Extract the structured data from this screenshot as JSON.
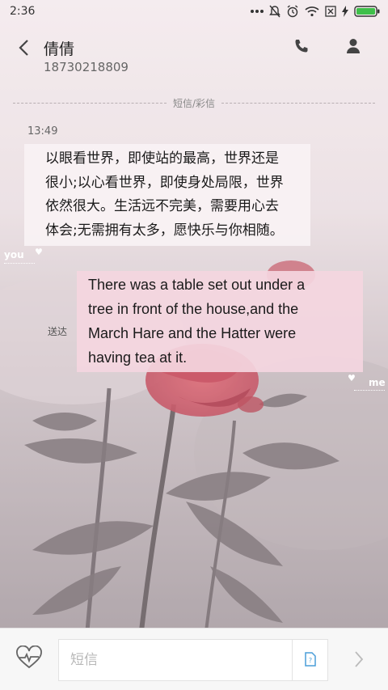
{
  "status_bar": {
    "time": "2:36",
    "icons": [
      "more-dots-icon",
      "mute-icon",
      "alarm-icon",
      "wifi-icon",
      "no-sim-icon",
      "charging-icon",
      "battery-icon"
    ]
  },
  "header": {
    "back_icon": "chevron-left-icon",
    "contact_name": "倩倩",
    "contact_number": "18730218809",
    "call_icon": "phone-icon",
    "profile_icon": "person-icon"
  },
  "conversation": {
    "channel_label": "短信/彩信",
    "timestamp": "13:49",
    "incoming": {
      "lines": [
        "以眼看世界，即使站的最高，世界还是",
        "很小;以心看世界，即使身处局限，世界",
        "依然很大。生活远不完美，需要用心去",
        "体会;无需拥有太多，愿快乐与你相随。"
      ],
      "tag": "you"
    },
    "outgoing": {
      "lines": [
        "There was a table set out under a",
        "tree in front of the house,and the",
        "March Hare and the Hatter were",
        "having tea at it."
      ],
      "tag": "me",
      "status": "送达"
    }
  },
  "input_bar": {
    "heart_icon": "heartbeat-icon",
    "placeholder": "短信",
    "sim_icon": "sim-card-icon",
    "send_icon": "chevron-right-icon"
  },
  "colors": {
    "background": "#f1e6ea",
    "incoming_bubble": "#f8f2f4",
    "outgoing_bubble": "#f4d6e0",
    "rose": "#c84050",
    "input_bar": "#f7f7f7"
  }
}
